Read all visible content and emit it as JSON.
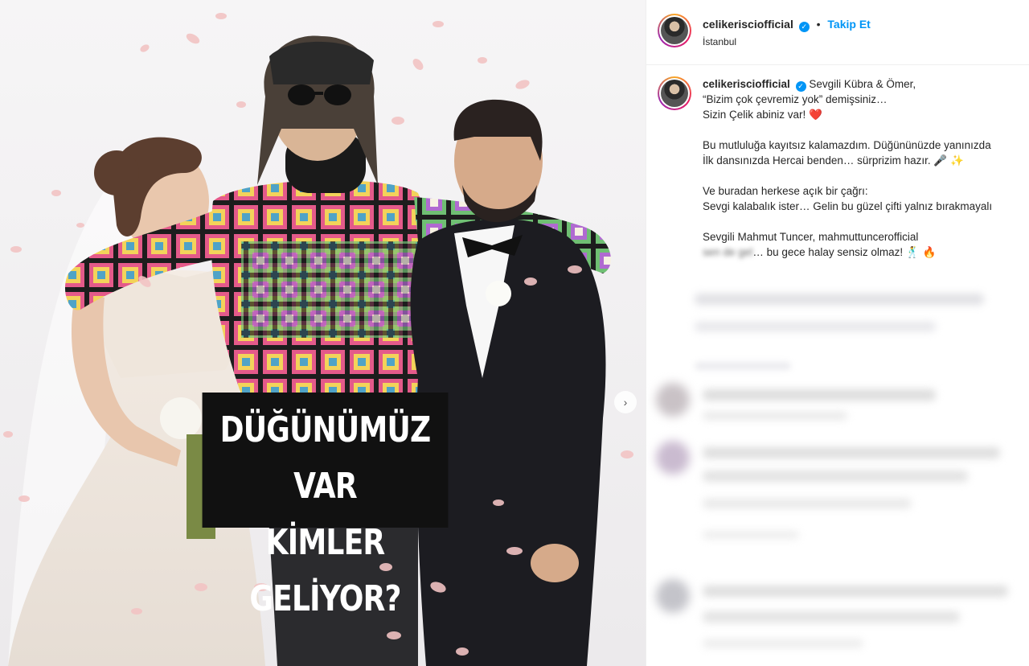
{
  "post": {
    "image": {
      "overlay_lines": [
        "DÜĞÜNÜMÜZ VAR",
        "KİMLER GELİYOR?"
      ],
      "next_icon": "chevron-right-icon"
    },
    "header": {
      "username": "celikerisciofficial",
      "verified_icon": "verified-badge-icon",
      "separator": "•",
      "follow_label": "Takip Et",
      "location": "İstanbul"
    },
    "caption": {
      "username": "celikerisciofficial",
      "lines": [
        "Sevgili Kübra & Ömer,",
        "“Bizim çok çevremiz yok” demişsiniz…",
        "Sizin Çelik abiniz var! ❤️",
        "",
        "Bu mutluluğa kayıtsız kalamazdım. Düğününüzde yanınızda",
        "İlk dansınızda Hercai benden… sürprizim hazır. 🎤 ✨",
        "",
        "Ve buradan herkese açık bir çağrı:",
        "Sevgi kalabalık ister… Gelin bu güzel çifti yalnız bırakmayalı",
        "",
        "Sevgili Mahmut Tuncer, mahmuttuncerofficial"
      ],
      "last_line_blurred": "sen de gel",
      "last_line_rest": "… bu gece halay sensiz olmaz! 🕺 🔥"
    },
    "colors": {
      "link_blue": "#0095f6",
      "text": "#262626",
      "overlay_bg": "#111111",
      "overlay_text": "#ffffff"
    }
  }
}
